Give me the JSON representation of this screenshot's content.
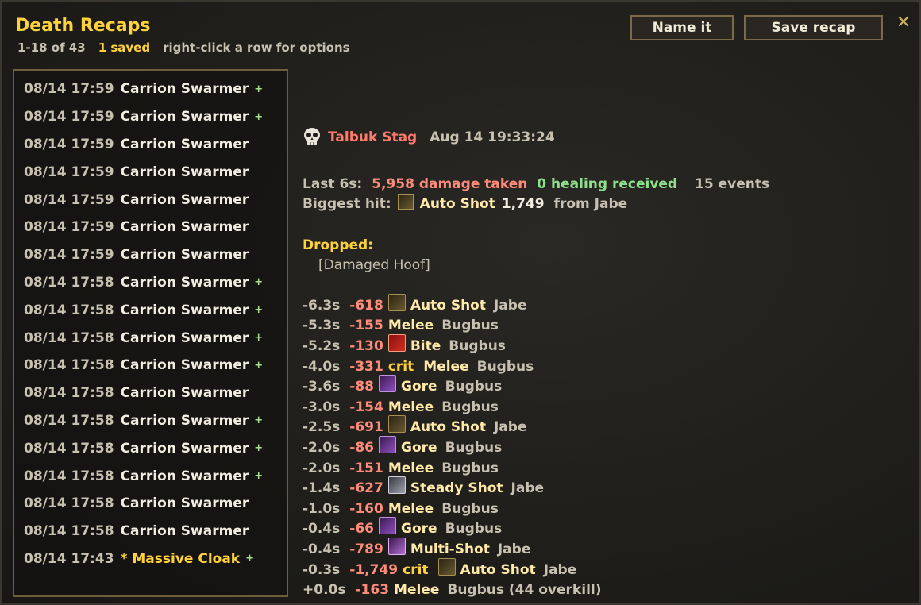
{
  "window": {
    "title": "Death Recaps",
    "count_text": "1-18 of 43",
    "saved_text": "1 saved",
    "hint_text": "right-click a row for options",
    "name_button": "Name it",
    "save_button": "Save recap",
    "close_glyph": "✕"
  },
  "recaps": [
    {
      "time": "08/14 17:59",
      "name": "Carrion Swarmer",
      "plus": "+"
    },
    {
      "time": "08/14 17:59",
      "name": "Carrion Swarmer",
      "plus": "+"
    },
    {
      "time": "08/14 17:59",
      "name": "Carrion Swarmer",
      "plus": ""
    },
    {
      "time": "08/14 17:59",
      "name": "Carrion Swarmer",
      "plus": ""
    },
    {
      "time": "08/14 17:59",
      "name": "Carrion Swarmer",
      "plus": ""
    },
    {
      "time": "08/14 17:59",
      "name": "Carrion Swarmer",
      "plus": ""
    },
    {
      "time": "08/14 17:59",
      "name": "Carrion Swarmer",
      "plus": ""
    },
    {
      "time": "08/14 17:58",
      "name": "Carrion Swarmer",
      "plus": "+"
    },
    {
      "time": "08/14 17:58",
      "name": "Carrion Swarmer",
      "plus": "+"
    },
    {
      "time": "08/14 17:58",
      "name": "Carrion Swarmer",
      "plus": "+"
    },
    {
      "time": "08/14 17:58",
      "name": "Carrion Swarmer",
      "plus": "+"
    },
    {
      "time": "08/14 17:58",
      "name": "Carrion Swarmer",
      "plus": ""
    },
    {
      "time": "08/14 17:58",
      "name": "Carrion Swarmer",
      "plus": "+"
    },
    {
      "time": "08/14 17:58",
      "name": "Carrion Swarmer",
      "plus": "+"
    },
    {
      "time": "08/14 17:58",
      "name": "Carrion Swarmer",
      "plus": "+"
    },
    {
      "time": "08/14 17:58",
      "name": "Carrion Swarmer",
      "plus": ""
    },
    {
      "time": "08/14 17:58",
      "name": "Carrion Swarmer",
      "plus": ""
    },
    {
      "time": "08/14 17:43",
      "name": "* Massive Cloak",
      "plus": "+",
      "saved": true
    }
  ],
  "detail": {
    "victim_icon": "skull-icon",
    "victim_name": "Talbuk Stag",
    "victim_time": "Aug 14 19:33:24",
    "last_label": "Last 6s:",
    "damage_taken": "5,958 damage taken",
    "healing": "0 healing received",
    "events_count": "15 events",
    "biggest_label": "Biggest hit:",
    "biggest_spell": "Auto Shot",
    "biggest_amount": "1,749",
    "biggest_source": "from Jabe",
    "dropped_label": "Dropped:",
    "dropped_item": "[Damaged Hoof]"
  },
  "events": [
    {
      "t": "-6.3s",
      "amount": "-618",
      "crit": "",
      "icon": "ic-shot",
      "spell": "Auto Shot",
      "source": "Jabe"
    },
    {
      "t": "-5.3s",
      "amount": "-155",
      "crit": "",
      "icon": "",
      "spell": "Melee",
      "source": "Bugbus"
    },
    {
      "t": "-5.2s",
      "amount": "-130",
      "crit": "",
      "icon": "ic-bite",
      "spell": "Bite",
      "source": "Bugbus"
    },
    {
      "t": "-4.0s",
      "amount": "-331",
      "crit": "crit",
      "icon": "",
      "spell": "Melee",
      "source": "Bugbus"
    },
    {
      "t": "-3.6s",
      "amount": "-88",
      "crit": "",
      "icon": "ic-gore",
      "spell": "Gore",
      "source": "Bugbus"
    },
    {
      "t": "-3.0s",
      "amount": "-154",
      "crit": "",
      "icon": "",
      "spell": "Melee",
      "source": "Bugbus"
    },
    {
      "t": "-2.5s",
      "amount": "-691",
      "crit": "",
      "icon": "ic-shot",
      "spell": "Auto Shot",
      "source": "Jabe"
    },
    {
      "t": "-2.0s",
      "amount": "-86",
      "crit": "",
      "icon": "ic-gore",
      "spell": "Gore",
      "source": "Bugbus"
    },
    {
      "t": "-2.0s",
      "amount": "-151",
      "crit": "",
      "icon": "",
      "spell": "Melee",
      "source": "Bugbus"
    },
    {
      "t": "-1.4s",
      "amount": "-627",
      "crit": "",
      "icon": "ic-steady",
      "spell": "Steady Shot",
      "source": "Jabe"
    },
    {
      "t": "-1.0s",
      "amount": "-160",
      "crit": "",
      "icon": "",
      "spell": "Melee",
      "source": "Bugbus"
    },
    {
      "t": "-0.4s",
      "amount": "-66",
      "crit": "",
      "icon": "ic-gore",
      "spell": "Gore",
      "source": "Bugbus"
    },
    {
      "t": "-0.4s",
      "amount": "-789",
      "crit": "",
      "icon": "ic-multi",
      "spell": "Multi-Shot",
      "source": "Jabe"
    },
    {
      "t": "-0.3s",
      "amount": "-1,749",
      "crit": "crit",
      "icon": "ic-shot",
      "spell": "Auto Shot",
      "source": "Jabe"
    },
    {
      "t": "+0.0s",
      "amount": "-163",
      "crit": "",
      "icon": "",
      "spell": "Melee",
      "source": "Bugbus (44 overkill)"
    }
  ]
}
